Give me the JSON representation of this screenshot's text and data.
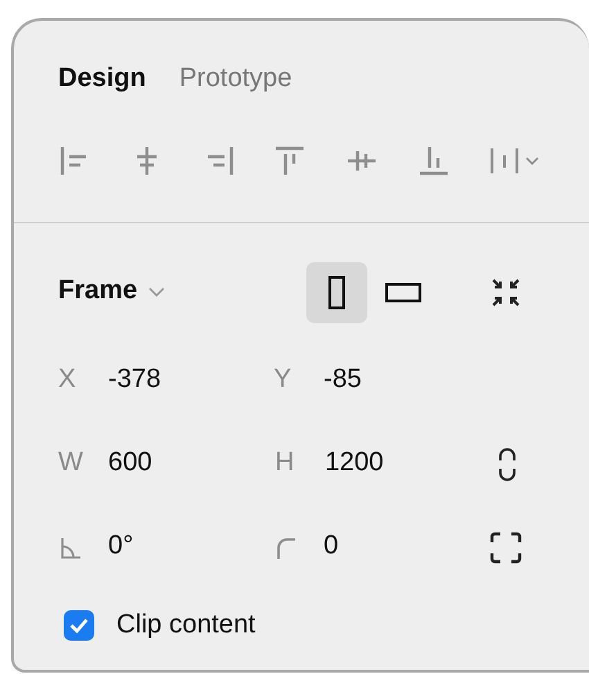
{
  "tabs": [
    {
      "label": "Design",
      "selected": true
    },
    {
      "label": "Prototype",
      "selected": false
    }
  ],
  "frame": {
    "label": "Frame",
    "orientation": [
      {
        "kind": "portrait",
        "selected": true
      },
      {
        "kind": "landscape",
        "selected": false
      }
    ]
  },
  "rows": [
    {
      "fields": [
        {
          "kind": "text",
          "label": "X",
          "value": "-378"
        },
        {
          "kind": "text",
          "label": "Y",
          "value": "-85"
        }
      ]
    },
    {
      "fields": [
        {
          "kind": "text",
          "label": "W",
          "value": "600"
        },
        {
          "kind": "text",
          "label": "H",
          "value": "1200"
        }
      ],
      "action": {
        "kind": "constrain"
      }
    },
    {
      "fields": [
        {
          "kind": "rotation",
          "value": "0°"
        },
        {
          "kind": "radius",
          "value": "0"
        }
      ],
      "action": {
        "kind": "corners"
      }
    }
  ],
  "clip_content": {
    "label": "Clip content",
    "checked": true
  }
}
